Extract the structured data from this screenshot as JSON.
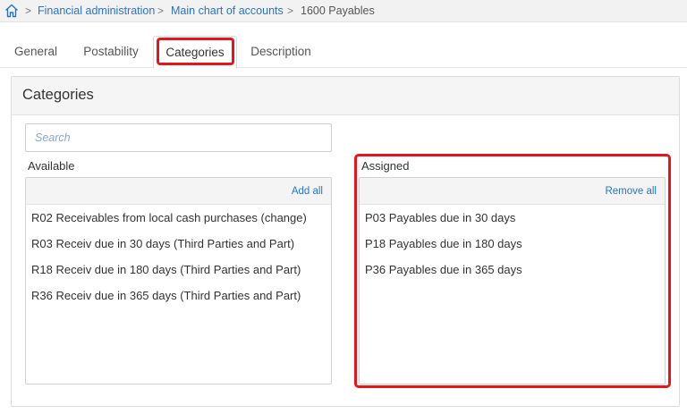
{
  "breadcrumb": {
    "items": [
      {
        "label": "Financial administration"
      },
      {
        "label": "Main chart of accounts"
      },
      {
        "label": "1600 Payables"
      }
    ],
    "separator": ">"
  },
  "tabs": [
    {
      "label": "General"
    },
    {
      "label": "Postability"
    },
    {
      "label": "Categories"
    },
    {
      "label": "Description"
    }
  ],
  "panel": {
    "title": "Categories",
    "search_placeholder": "Search",
    "available": {
      "label": "Available",
      "action": "Add all",
      "items": [
        "R02 Receivables from local cash purchases (change)",
        "R03 Receiv due in 30 days (Third Parties and Part)",
        "R18 Receiv due in 180 days (Third Parties and Part)",
        "R36 Receiv due in 365 days (Third Parties and Part)"
      ]
    },
    "assigned": {
      "label": "Assigned",
      "action": "Remove all",
      "items": [
        "P03 Payables due in 30 days",
        "P18 Payables due in 180 days",
        "P36 Payables due in 365 days"
      ]
    }
  },
  "colors": {
    "link": "#2b74c4",
    "highlight": "#e8141c"
  }
}
